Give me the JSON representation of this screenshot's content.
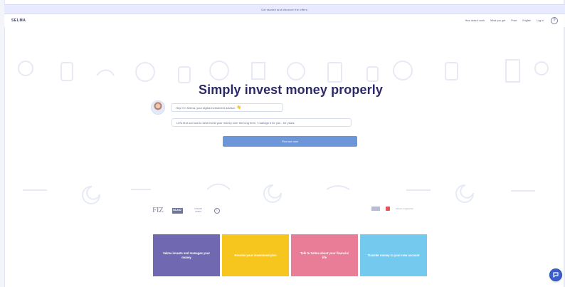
{
  "announcement": {
    "text": "Get started and discover the offers."
  },
  "header": {
    "logo": "SELMA",
    "nav": [
      "How does it work",
      "What you get",
      "Price",
      "English",
      "Log in"
    ],
    "profile_icon": "?"
  },
  "hero": {
    "title": "Simply invest money properly",
    "message_1": "Hey! I'm Selma, your digital investment advisor.",
    "message_1_emoji": "👋",
    "message_2": "Let's find out how to best invest your money over the long term. I manage it for you - for years.",
    "cta": "Find out now"
  },
  "press": {
    "left": [
      "FIZ",
      "BILANZ",
      "FINANZ TIMES",
      "©"
    ],
    "right_text": "Aktuell vergleichen"
  },
  "cards": [
    "Selma invests and manages your money",
    "Receive your investment plan",
    "Talk to Selma about your financial life",
    "Transfer money to your new account"
  ],
  "widgets": {
    "chat_icon": "chat-icon"
  },
  "colors": {
    "primary": "#6d95d9",
    "title": "#2d2a67",
    "card_1": "#7069b1",
    "card_2": "#f7c61e",
    "card_3": "#e97c97",
    "card_4": "#74c9ef"
  }
}
